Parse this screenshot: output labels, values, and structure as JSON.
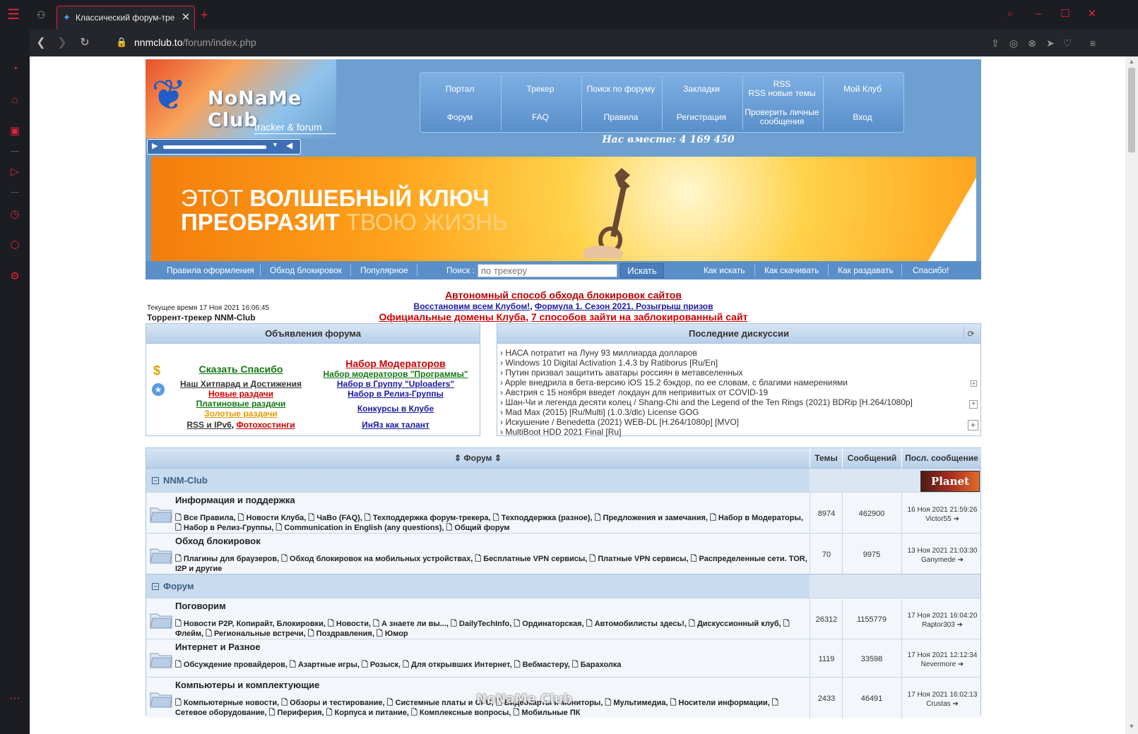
{
  "browser": {
    "tab_title": "Классический форум-тре",
    "url_host": "nnmclub.to",
    "url_path": "/forum/index.php"
  },
  "site": {
    "logo_text": "NoNaMe Club",
    "logo_sub": "tracker & forum",
    "nav_top": [
      "Портал",
      "Трекер",
      "Поиск по форуму",
      "Закладки",
      "RSS\nRSS новые темы",
      "Мой Клуб"
    ],
    "nav_bottom": [
      "Форум",
      "FAQ",
      "Правила",
      "Регистрация",
      "Проверить личные сообщения",
      "Вход"
    ],
    "together": "Нас вместе: 4 169 450",
    "banner_line1_normal": "ЭТОТ ",
    "banner_line1_bold": "ВОЛШЕБНЫЙ КЛЮЧ",
    "banner_line2_bold": "ПРЕОБРАЗИТ ",
    "banner_line2_faint": "ТВОЮ ЖИЗНЬ",
    "subnav": [
      "Правила оформления",
      "Обход блокировок",
      "Популярное"
    ],
    "search_label": "Поиск :",
    "search_placeholder": "по трекеру",
    "search_button": "Искать",
    "subnav_right": [
      "Как искать",
      "Как скачивать",
      "Как раздавать",
      "Спасибо!"
    ]
  },
  "announcements": {
    "line1": "Автономный способ обхода блокировок сайтов",
    "line2a": "Восстановим всем Клубом!",
    "line2b": "Формула 1. Сезон 2021. Розыгрыш призов",
    "line3a": "Официальные домены Клуба",
    "line3b": "7 способов зайти на заблокированный сайт",
    "current_time": "Текущее время 17 Ноя 2021 16:06:45",
    "tracker_name": "Торрент-трекер NNM-Club"
  },
  "panel_left": {
    "title": "Объявления форума",
    "left_links": [
      "Сказать Спасибо",
      "Наш Хитпарад и Достижения",
      "Новые раздачи",
      "Платиновые раздачи",
      "Золотые раздачи",
      "RSS и IPv6",
      "Фотохостинги"
    ],
    "right_links": [
      "Набор Модераторов",
      "Набор модераторов \"Программы\"",
      "Набор в Группу \"Uploaders\"",
      "Набор в Релиз-Группы",
      "Конкурсы в Клубе",
      "ИнЯз как талант"
    ]
  },
  "panel_right": {
    "title": "Последние дискуссии",
    "items": [
      "› НАСА потратит на Луну 93 миллиарда долларов",
      "› Windows 10 Digital Activation 1.4.3 by Ratiborus [Ru/En]",
      "› Путин призвал защитить аватары россиян в метавселенных",
      "› Apple внедрила в бета-версию iOS 15.2 бэкдор, по ее словам, с благими намерениями",
      "› Австрия с 15 ноября введет локдаун для непривитых от COVID-19",
      "› Шан-Чи и легенда десяти колец / Shang-Chi and the Legend of the Ten Rings (2021) BDRip [H.264/1080p]",
      "› Mad Max (2015) [Ru/Multi] (1.0.3/dlc) License GOG",
      "› Искушение / Benedetta (2021) WEB-DL [H.264/1080p] [MVO]",
      "› MultiBoot HDD 2021 Final [Ru]"
    ]
  },
  "forum": {
    "headers": [
      "Форум",
      "Темы",
      "Сообщений",
      "Посл. сообщение"
    ],
    "planet_logo": "Planet",
    "categories": [
      "NNM-Club",
      "Форум"
    ],
    "rows": [
      {
        "title": "Информация и поддержка",
        "subs": "🗋 Все Правила, 🗋 Новости Клуба, 🗋 ЧаВо (FAQ), 🗋 Техподдержка форум-трекера, 🗋 Техподдержка (разное), 🗋 Предложения и замечания, 🗋 Набор в Модераторы, 🗋 Набор в Релиз-Группы, 🗋 Communication in English (any questions), 🗋 Общий форум",
        "topics": "8974",
        "posts": "462900",
        "last_date": "16 Ноя 2021 21:59:26",
        "last_user": "Victor55"
      },
      {
        "title": "Обход блокировок",
        "subs": "🗋 Плагины для браузеров, 🗋 Обход блокировок на мобильных устройствах, 🗋 Бесплатные VPN сервисы, 🗋 Платные VPN сервисы, 🗋 Распределенные сети. TOR, I2P и другие",
        "topics": "70",
        "posts": "9975",
        "last_date": "13 Ноя 2021 21:03:30",
        "last_user": "Ganymede"
      },
      {
        "title": "Поговорим",
        "subs": "🗋 Новости P2P, Копирайт, Блокировки, 🗋 Новости, 🗋 А знаете ли вы..., 🗋 DailyTechInfo, 🗋 Ординаторская, 🗋 Автомобилисты здесь!, 🗋 Дискуссионный клуб, 🗋 Флейм, 🗋 Региональные встречи, 🗋 Поздравления, 🗋 Юмор",
        "topics": "26312",
        "posts": "1155779",
        "last_date": "17 Ноя 2021 16:04:20",
        "last_user": "Raptor303"
      },
      {
        "title": "Интернет и Разное",
        "subs": "🗋 Обсуждение провайдеров, 🗋 Азартные игры, 🗋 Розыск, 🗋 Для открывших Интернет, 🗋 Вебмастеру, 🗋 Барахолка",
        "topics": "1119",
        "posts": "33598",
        "last_date": "17 Ноя 2021 12:12:34",
        "last_user": "Nevermore"
      },
      {
        "title": "Компьютеры и комплектующие",
        "subs": "🗋 Компьютерные новости, 🗋 Обзоры и тестирование, 🗋 Системные платы и CPU, 🗋 Видеокарты и мониторы, 🗋 Мультимедиа, 🗋 Носители информации, 🗋 Сетевое оборудование, 🗋 Периферия, 🗋 Корпуса и питание, 🗋 Комплексные вопросы, 🗋 Мобильные ПК",
        "topics": "2433",
        "posts": "46491",
        "last_date": "17 Ноя 2021 16:02:13",
        "last_user": "Crustas"
      }
    ]
  },
  "watermark": "NoNaMe Club",
  "colors": {
    "accent": "#e0223a",
    "header_blue": "#6d9fd0",
    "link_blue": "#1a1aa6",
    "link_red": "#cc0000",
    "link_green": "#117711",
    "link_orange": "#e89a00"
  }
}
